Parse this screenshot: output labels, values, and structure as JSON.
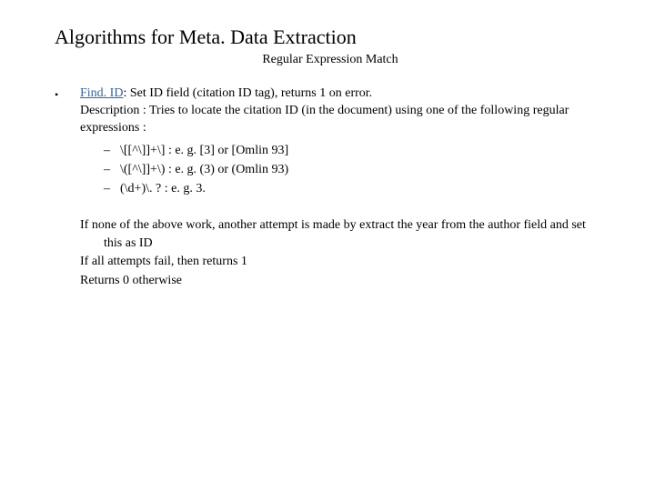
{
  "title": "Algorithms for Meta. Data Extraction",
  "subtitle": "Regular Expression Match",
  "bullet": "•",
  "fn_name": "Find. ID",
  "fn_sep": ": ",
  "fn_tail": "Set ID field (citation ID tag), returns 1 on error.",
  "desc_label": "Description :",
  "desc_text": " Tries to locate the citation ID (in the document) using one of the following regular expressions :",
  "regex": [
    "\\[[^\\]]+\\] : e. g. [3] or [Omlin 93]",
    "\\([^\\]]+\\) : e. g. (3) or (Omlin 93)",
    "(\\d+)\\. ? : e. g. 3."
  ],
  "p1": "If none of the above work, another attempt is made by extract the year from the author field and set this as ID",
  "p2": "If all attempts fail, then returns 1",
  "p3": "Returns 0 otherwise"
}
